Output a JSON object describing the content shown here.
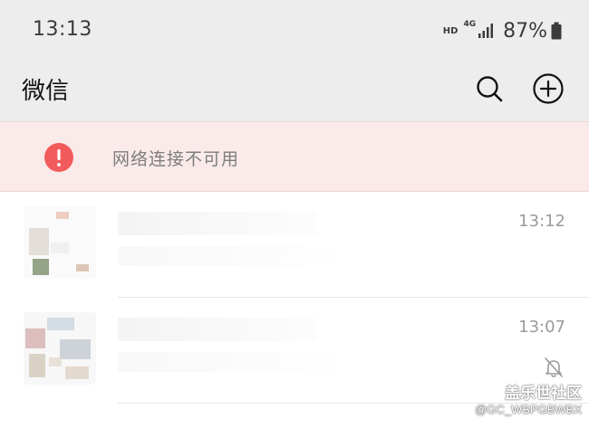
{
  "status_bar": {
    "time": "13:13",
    "hd_label": "HD",
    "network_label": "4G",
    "battery_percent": "87%"
  },
  "nav": {
    "title": "微信",
    "search_icon": "search-icon",
    "add_icon": "plus-circle-icon"
  },
  "alert": {
    "icon": "exclamation-icon",
    "text": "网络连接不可用",
    "icon_color": "#f25b5b"
  },
  "chats": [
    {
      "time": "13:12",
      "muted": false
    },
    {
      "time": "13:07",
      "muted": true
    }
  ],
  "watermark": {
    "title": "盖乐世社区",
    "handle": "@GC_WBPGBWBX"
  },
  "colors": {
    "header_bg": "#ededed",
    "alert_bg": "#fbeaea",
    "time_text": "#9a9a9a"
  }
}
